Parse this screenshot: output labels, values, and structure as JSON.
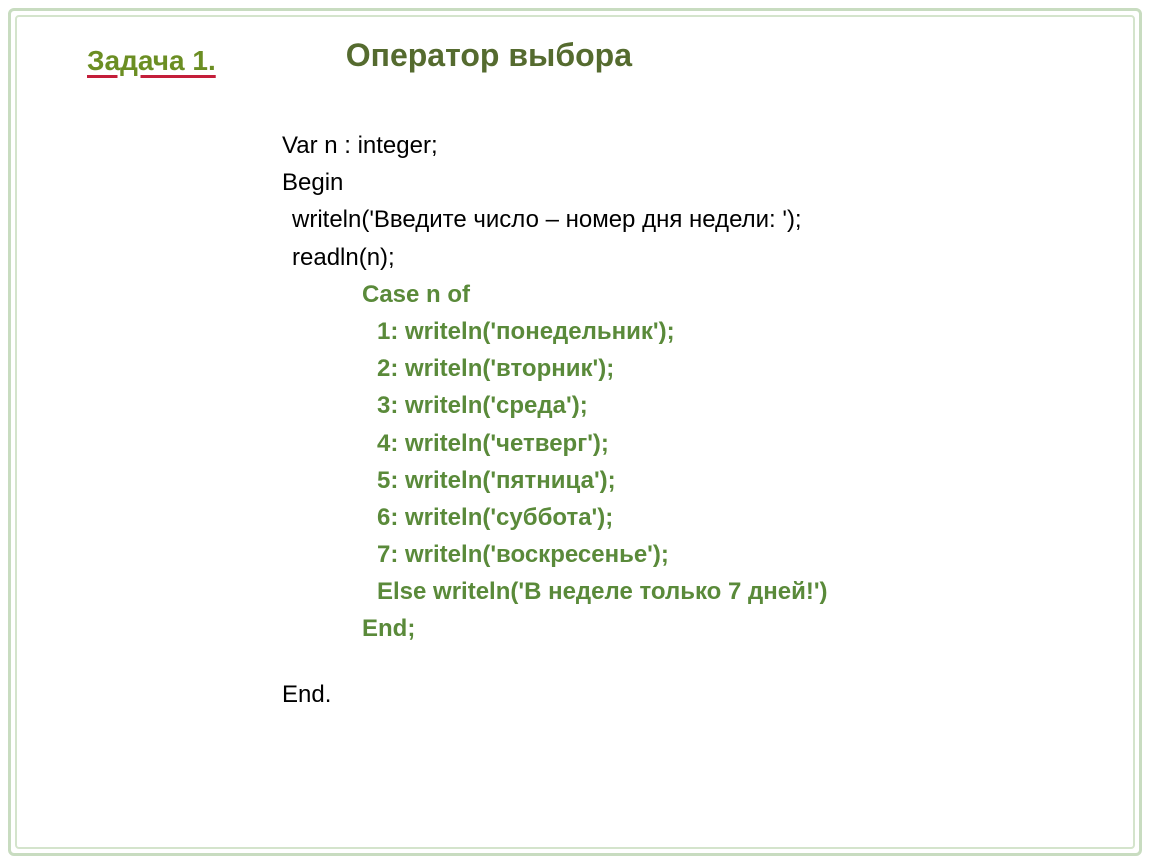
{
  "task_label": "Задача 1.",
  "title": "Оператор выбора",
  "code": {
    "var_decl": "Var  n : integer;",
    "begin": "Begin",
    "writeln_prompt": "writeln('Введите число – номер дня недели: ');",
    "readln": "readln(n);",
    "case_start": "Case n of",
    "case1": "1: writeln('понедельник');",
    "case2": "2: writeln('вторник');",
    "case3": "3: writeln('среда');",
    "case4": "4: writeln('четверг');",
    "case5": "5: writeln('пятница');",
    "case6": "6: writeln('суббота');",
    "case7": "7: writeln('воскресенье');",
    "else_line": "Else writeln('В неделе только 7 дней!')",
    "end_case": "End;",
    "end_prog": "End."
  }
}
